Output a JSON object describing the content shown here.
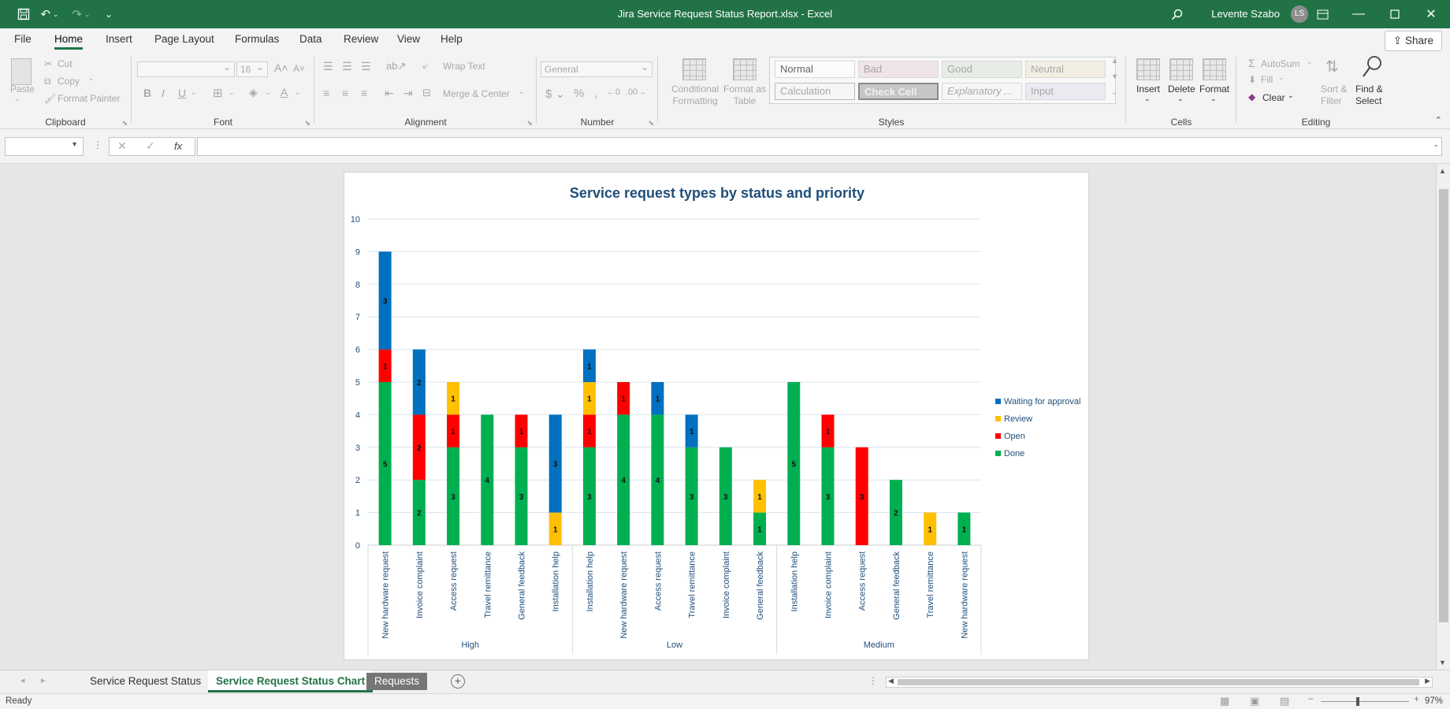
{
  "window": {
    "title": "Jira Service Request Status Report.xlsx  -  Excel",
    "user_name": "Levente Szabo",
    "user_initials": "LS"
  },
  "menu": {
    "tabs": [
      "File",
      "Home",
      "Insert",
      "Page Layout",
      "Formulas",
      "Data",
      "Review",
      "View",
      "Help"
    ],
    "active": "Home",
    "share_label": "Share"
  },
  "ribbon": {
    "clipboard": {
      "label": "Clipboard",
      "paste": "Paste",
      "cut": "Cut",
      "copy": "Copy",
      "format_painter": "Format Painter"
    },
    "font": {
      "label": "Font",
      "font_name": "",
      "font_size": "16"
    },
    "alignment": {
      "label": "Alignment",
      "wrap_text": "Wrap Text",
      "merge_center": "Merge & Center"
    },
    "number": {
      "label": "Number",
      "format": "General"
    },
    "styles": {
      "label": "Styles",
      "conditional_formatting": "Conditional Formatting",
      "format_as_table": "Format as Table",
      "cells": [
        "Normal",
        "Bad",
        "Good",
        "Neutral",
        "Calculation",
        "Check Cell",
        "Explanatory ...",
        "Input"
      ]
    },
    "cells": {
      "label": "Cells",
      "insert": "Insert",
      "delete": "Delete",
      "format": "Format"
    },
    "editing": {
      "label": "Editing",
      "autosum": "AutoSum",
      "fill": "Fill",
      "clear": "Clear",
      "sort_filter": "Sort & Filter",
      "find_select": "Find & Select"
    }
  },
  "formula_bar": {
    "name_box": "",
    "formula": ""
  },
  "chart_data": {
    "type": "bar",
    "stacked": true,
    "title": "Service request types by status and priority",
    "ylim": [
      0,
      10
    ],
    "y_ticks": [
      "0",
      "1",
      "2",
      "3",
      "4",
      "5",
      "6",
      "7",
      "8",
      "9",
      "10"
    ],
    "groups": [
      {
        "label": "High",
        "count": 6
      },
      {
        "label": "Low",
        "count": 6
      },
      {
        "label": "Medium",
        "count": 6
      }
    ],
    "categories": [
      "New hardware request",
      "Invoice complaint",
      "Access request",
      "Travel remittance",
      "General feedback",
      "Installation help",
      "Installation help",
      "New hardware request",
      "Access request",
      "Travel remittance",
      "Invoice complaint",
      "General feedback",
      "Installation help",
      "Invoice complaint",
      "Access request",
      "General feedback",
      "Travel remittance",
      "New hardware request"
    ],
    "series": [
      {
        "name": "Done",
        "color": "#00b050",
        "values": [
          5,
          2,
          3,
          4,
          3,
          0,
          3,
          4,
          4,
          3,
          3,
          1,
          5,
          3,
          0,
          2,
          0,
          1
        ]
      },
      {
        "name": "Open",
        "color": "#ff0000",
        "values": [
          1,
          2,
          1,
          0,
          1,
          0,
          1,
          1,
          0,
          0,
          0,
          0,
          0,
          1,
          3,
          0,
          0,
          0
        ]
      },
      {
        "name": "Review",
        "color": "#ffc000",
        "values": [
          0,
          0,
          1,
          0,
          0,
          1,
          1,
          0,
          0,
          0,
          0,
          1,
          0,
          0,
          0,
          0,
          1,
          0
        ]
      },
      {
        "name": "Waiting for approval",
        "color": "#0070c0",
        "values": [
          3,
          2,
          0,
          0,
          0,
          3,
          1,
          0,
          1,
          1,
          0,
          0,
          0,
          0,
          0,
          0,
          0,
          0
        ]
      }
    ],
    "legend": "right",
    "legend_order": [
      "Waiting for approval",
      "Review",
      "Open",
      "Done"
    ],
    "grid": true
  },
  "sheet_tabs": [
    {
      "label": "Service Request Status",
      "state": "normal"
    },
    {
      "label": "Service Request Status Chart",
      "state": "active"
    },
    {
      "label": "Requests",
      "state": "grey"
    }
  ],
  "status": {
    "ready": "Ready",
    "zoom": "97%"
  }
}
